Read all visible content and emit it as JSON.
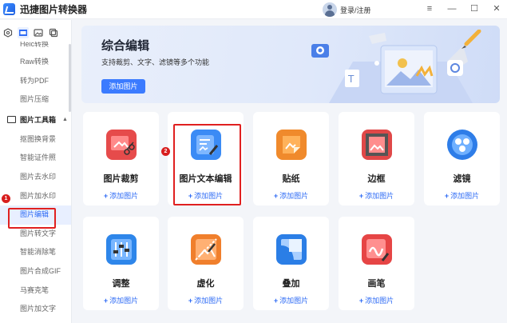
{
  "app": {
    "title": "迅捷图片转换器"
  },
  "header": {
    "login_text": "登录/注册"
  },
  "window_controls": [
    "≡",
    "—",
    "☐",
    "✕"
  ],
  "sidebar": {
    "partial_item": "Heic转换",
    "items_before": [
      "Raw转换",
      "转为PDF",
      "图片压缩"
    ],
    "group_label": "图片工具箱",
    "items_after": [
      "抠图换背景",
      "智能证件照",
      "图片去水印",
      "图片加水印",
      "图片编辑",
      "图片转文字",
      "智能消除笔",
      "图片合成GIF",
      "马赛克笔",
      "图片加文字"
    ],
    "active_item": "图片编辑"
  },
  "markers": {
    "step1": "1",
    "step2": "2"
  },
  "banner": {
    "title": "综合编辑",
    "subtitle": "支持裁剪、文字、滤镜等多个功能",
    "button": "添加图片"
  },
  "cards": [
    {
      "title": "图片裁剪",
      "add": "添加图片",
      "icon": "crop-icon",
      "color": "#e64b4b"
    },
    {
      "title": "图片文本编辑",
      "add": "添加图片",
      "icon": "text-edit-icon",
      "color": "#3b8bf5"
    },
    {
      "title": "贴纸",
      "add": "添加图片",
      "icon": "sticker-icon",
      "color": "#f08a2c"
    },
    {
      "title": "边框",
      "add": "添加图片",
      "icon": "frame-icon",
      "color": "#e04848"
    },
    {
      "title": "滤镜",
      "add": "添加图片",
      "icon": "filter-icon",
      "color": "#2e7de8"
    },
    {
      "title": "调整",
      "add": "添加图片",
      "icon": "adjust-icon",
      "color": "#2e86ea"
    },
    {
      "title": "虚化",
      "add": "添加图片",
      "icon": "blur-icon",
      "color": "#f07f2c"
    },
    {
      "title": "叠加",
      "add": "添加图片",
      "icon": "overlay-icon",
      "color": "#2b7ee6"
    },
    {
      "title": "画笔",
      "add": "添加图片",
      "icon": "brush-icon",
      "color": "#e64545"
    }
  ],
  "add_prefix": "+"
}
